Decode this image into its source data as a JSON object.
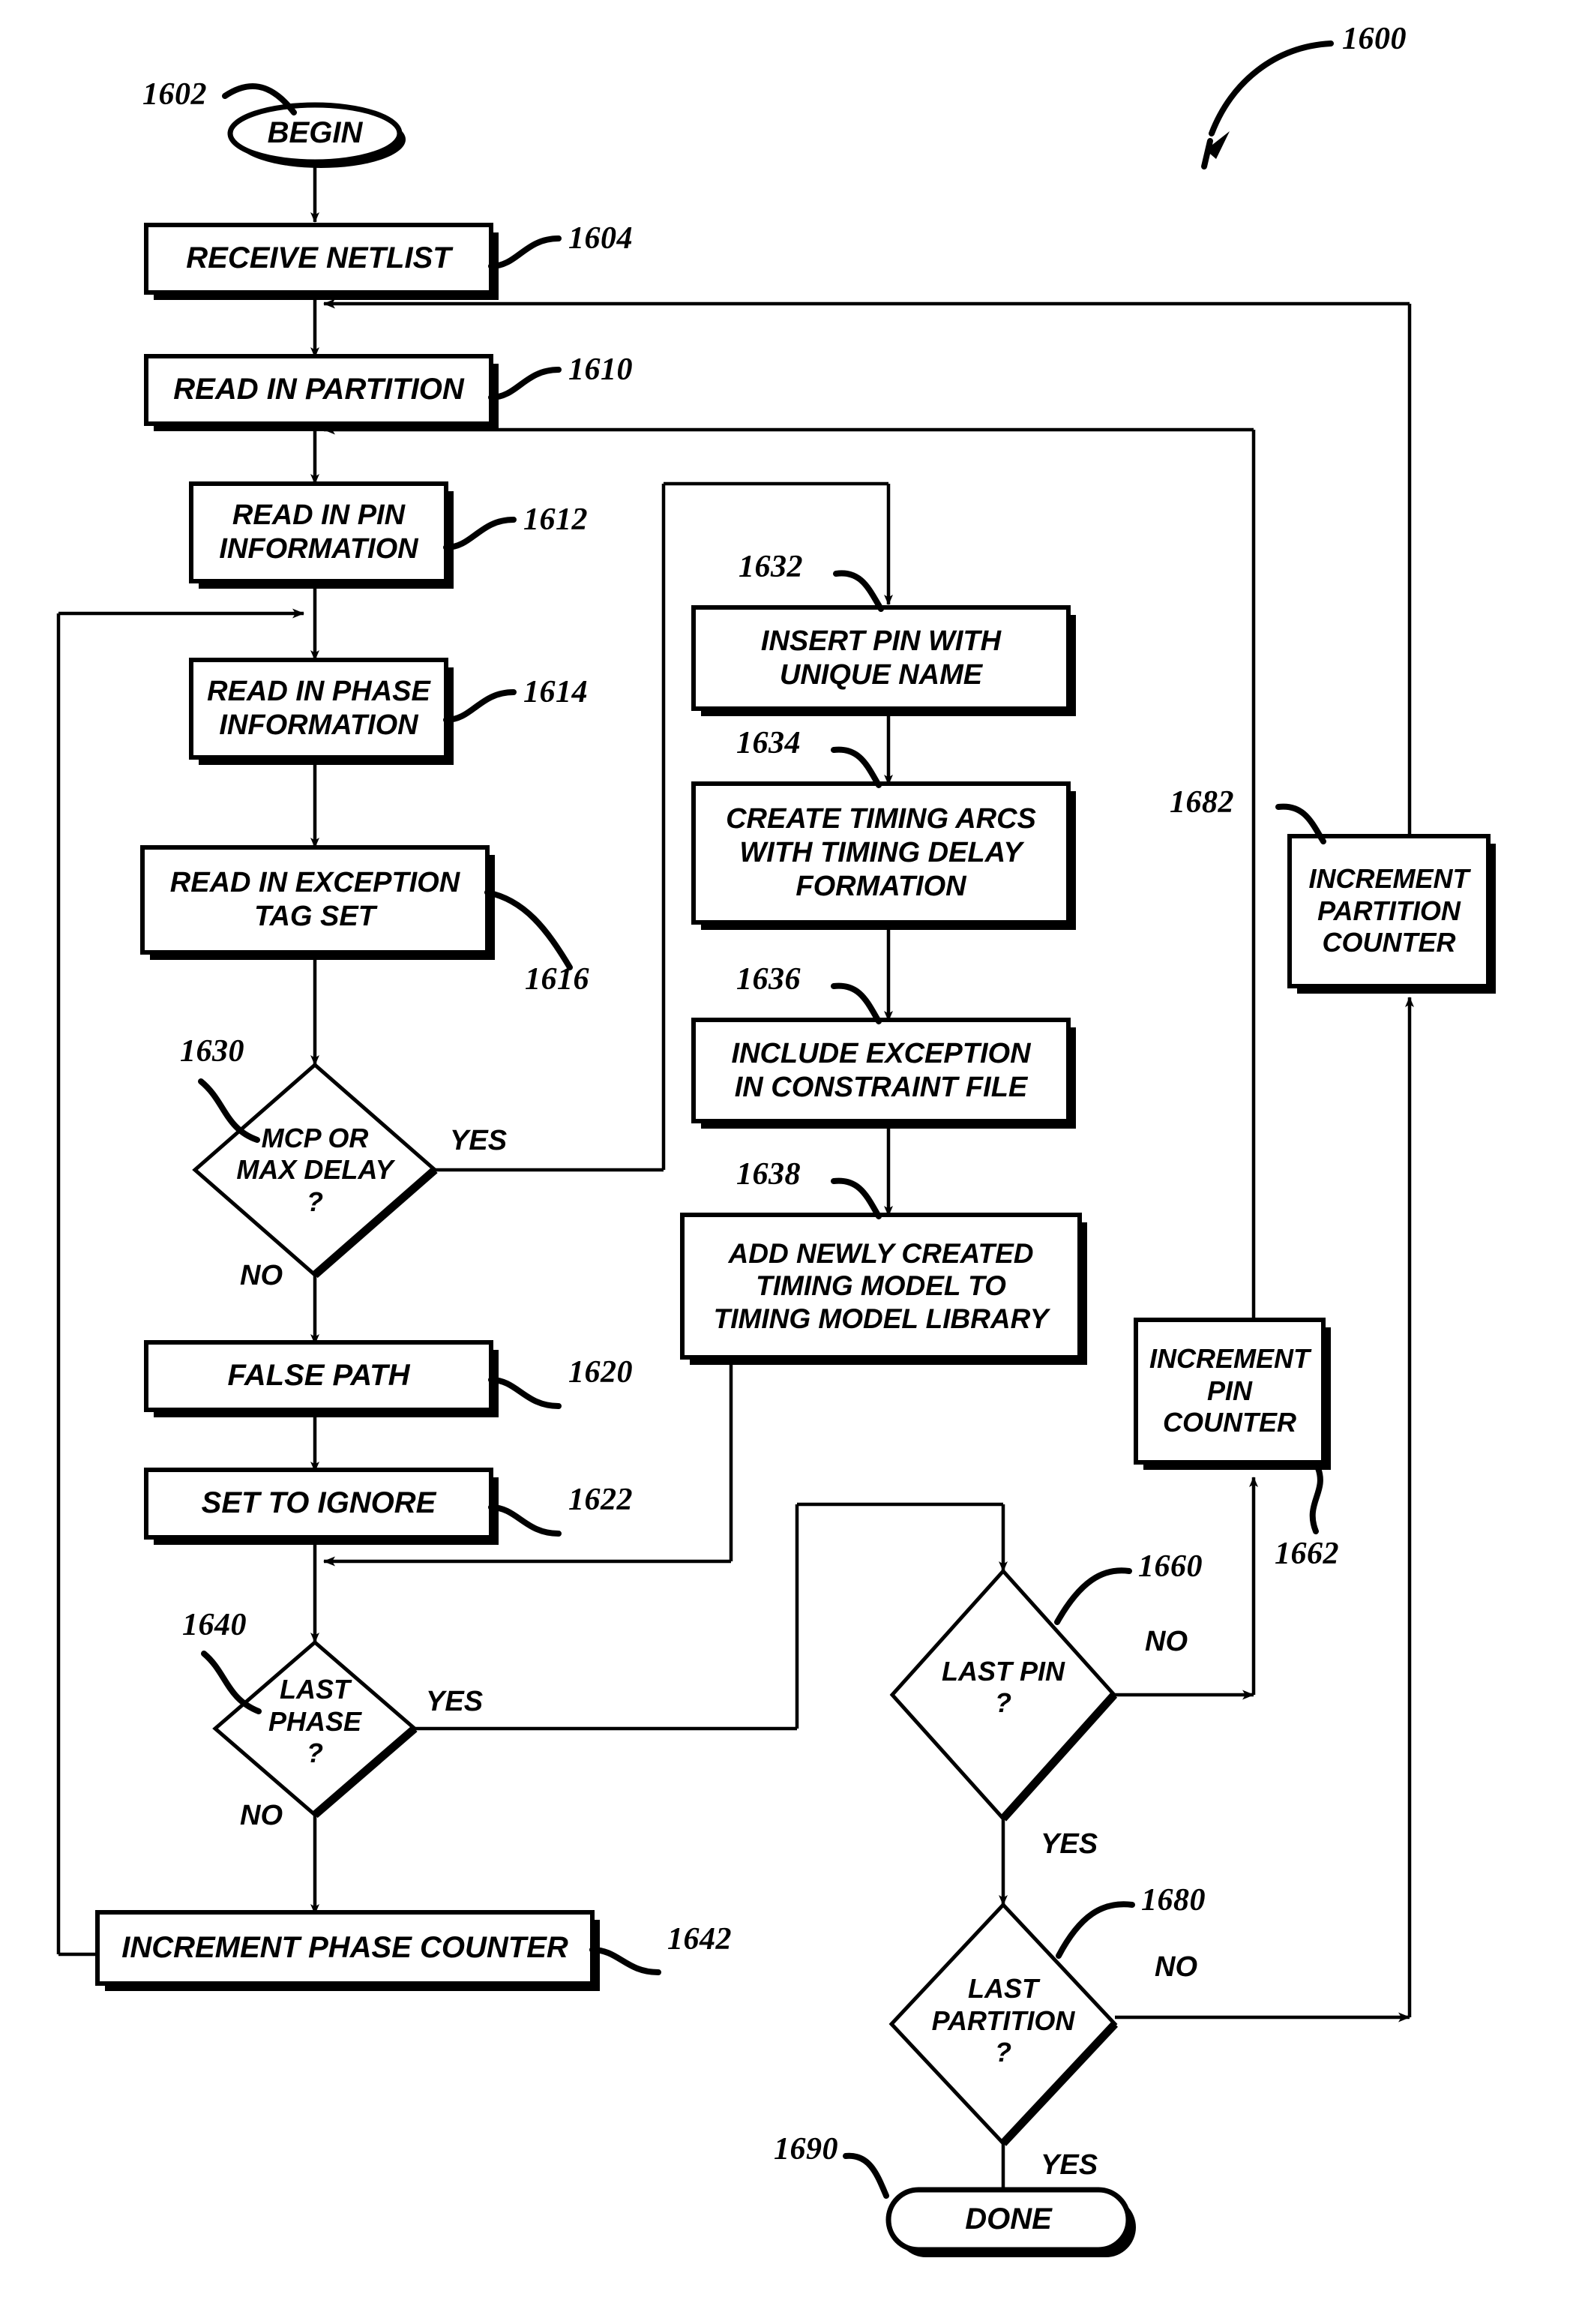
{
  "figure": {
    "number": "1600"
  },
  "nodes": {
    "begin": {
      "ref": "1602",
      "label": "BEGIN"
    },
    "receive_netlist": {
      "ref": "1604",
      "label": "RECEIVE NETLIST"
    },
    "read_partition": {
      "ref": "1610",
      "label": "READ IN PARTITION"
    },
    "read_pin_info": {
      "ref": "1612",
      "label": "READ IN PIN\nINFORMATION"
    },
    "read_phase_info": {
      "ref": "1614",
      "label": "READ IN PHASE\nINFORMATION"
    },
    "read_exception": {
      "ref": "1616",
      "label": "READ IN EXCEPTION\nTAG SET"
    },
    "mcp_or_max_delay": {
      "ref": "1630",
      "label": "MCP OR\nMAX DELAY\n?"
    },
    "false_path": {
      "ref": "1620",
      "label": "FALSE PATH"
    },
    "set_to_ignore": {
      "ref": "1622",
      "label": "SET TO IGNORE"
    },
    "last_phase": {
      "ref": "1640",
      "label": "LAST\nPHASE\n?"
    },
    "increment_phase": {
      "ref": "1642",
      "label": "INCREMENT PHASE COUNTER"
    },
    "insert_pin": {
      "ref": "1632",
      "label": "INSERT PIN WITH\nUNIQUE NAME"
    },
    "create_arcs": {
      "ref": "1634",
      "label": "CREATE TIMING ARCS\nWITH TIMING DELAY\nFORMATION"
    },
    "include_exception": {
      "ref": "1636",
      "label": "INCLUDE EXCEPTION\nIN CONSTRAINT FILE"
    },
    "add_model": {
      "ref": "1638",
      "label": "ADD NEWLY CREATED\nTIMING MODEL TO\nTIMING MODEL LIBRARY"
    },
    "increment_pin": {
      "ref": "1662",
      "label": "INCREMENT\nPIN\nCOUNTER"
    },
    "increment_part": {
      "ref": "1682",
      "label": "INCREMENT\nPARTITION\nCOUNTER"
    },
    "last_pin": {
      "ref": "1660",
      "label": "LAST PIN\n?"
    },
    "last_partition": {
      "ref": "1680",
      "label": "LAST\nPARTITION\n?"
    },
    "done": {
      "ref": "1690",
      "label": "DONE"
    }
  },
  "branch_labels": {
    "mcp_yes": "YES",
    "mcp_no": "NO",
    "last_phase_yes": "YES",
    "last_phase_no": "NO",
    "last_pin_no": "NO",
    "last_pin_yes": "YES",
    "last_partition_no": "NO",
    "last_partition_yes": "YES"
  },
  "style": {
    "stroke": "#000000",
    "fill": "#ffffff",
    "shadow": "#000000"
  }
}
